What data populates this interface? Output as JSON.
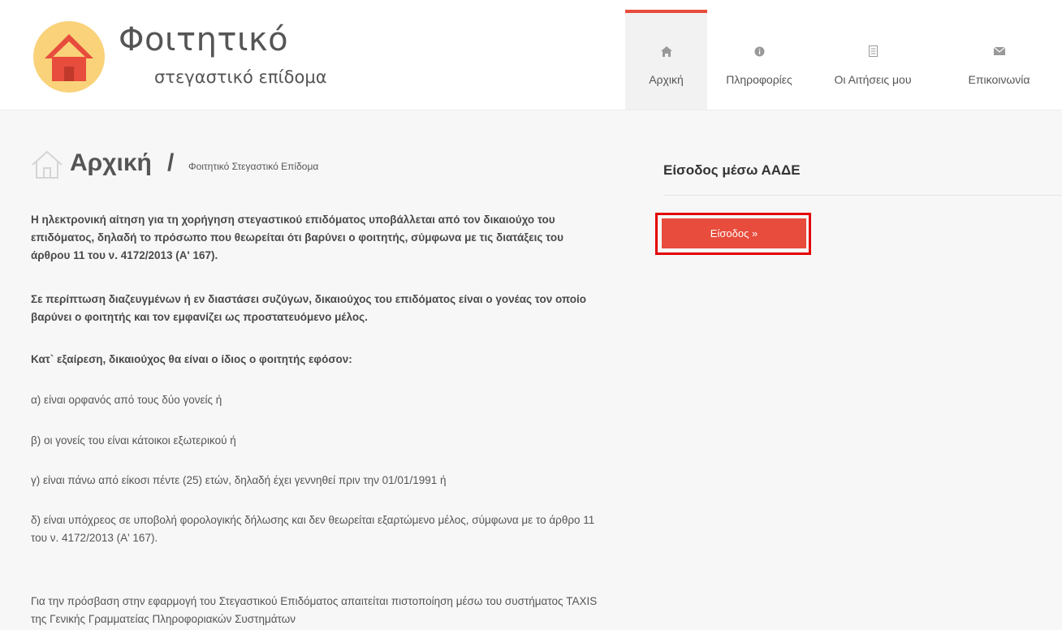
{
  "brand": {
    "title": "Φοιτητικό",
    "subtitle": "στεγαστικό επίδομα",
    "icon": "house-icon",
    "colors": {
      "circle": "#f9d27a",
      "roof": "#e74c3c"
    }
  },
  "nav": {
    "items": [
      {
        "label": "Αρχική",
        "icon": "home-icon",
        "active": true
      },
      {
        "label": "Πληροφορίες",
        "icon": "info-icon",
        "active": false
      },
      {
        "label": "Οι Αιτήσεις μου",
        "icon": "document-icon",
        "active": false
      },
      {
        "label": "Επικοινωνία",
        "icon": "envelope-icon",
        "active": false
      }
    ],
    "accent": "#e74c3c"
  },
  "breadcrumb": {
    "title": "Αρχική",
    "separator": "/",
    "sub": "Φοιτητικό Στεγαστικό Επίδομα"
  },
  "content": {
    "p1": "Η ηλεκτρονική αίτηση για τη χορήγηση στεγαστικού επιδόματος υποβάλλεται από τον δικαιούχο του επιδόματος, δηλαδή το πρόσωπο που θεωρείται ότι βαρύνει ο φοιτητής, σύμφωνα με τις διατάξεις του άρθρου 11 του ν. 4172/2013 (Α' 167).",
    "p2": "Σε περίπτωση διαζευγμένων ή εν διαστάσει συζύγων, δικαιούχος του επιδόματος είναι ο γονέας τον οποίο βαρύνει ο φοιτητής και τον εμφανίζει ως προστατευόμενο μέλος.",
    "p3": "Κατ` εξαίρεση, δικαιούχος θα είναι ο ίδιος ο φοιτητής εφόσον:",
    "a": "α) είναι ορφανός από τους δύο γονείς ή",
    "b": "β) οι γονείς του είναι κάτοικοι εξωτερικού ή",
    "c": "γ) είναι πάνω από είκοσι πέντε (25) ετών, δηλαδή έχει γεννηθεί πριν την 01/01/1991 ή",
    "d": "δ) είναι υπόχρεος σε υποβολή φορολογικής δήλωσης και δεν θεωρείται εξαρτώμενο μέλος, σύμφωνα με το άρθρο 11 του ν. 4172/2013 (Α' 167).",
    "p4": "Για την πρόσβαση στην εφαρμογή του Στεγαστικού Επιδόματος απαιτείται πιστοποίηση μέσω του συστήματος TAXIS της Γενικής Γραμματείας Πληροφοριακών Συστημάτων"
  },
  "login": {
    "title": "Είσοδος μέσω ΑΑΔΕ",
    "button": "Είσοδος »",
    "button_color": "#e74c3c",
    "highlight_color": "#e30000"
  }
}
